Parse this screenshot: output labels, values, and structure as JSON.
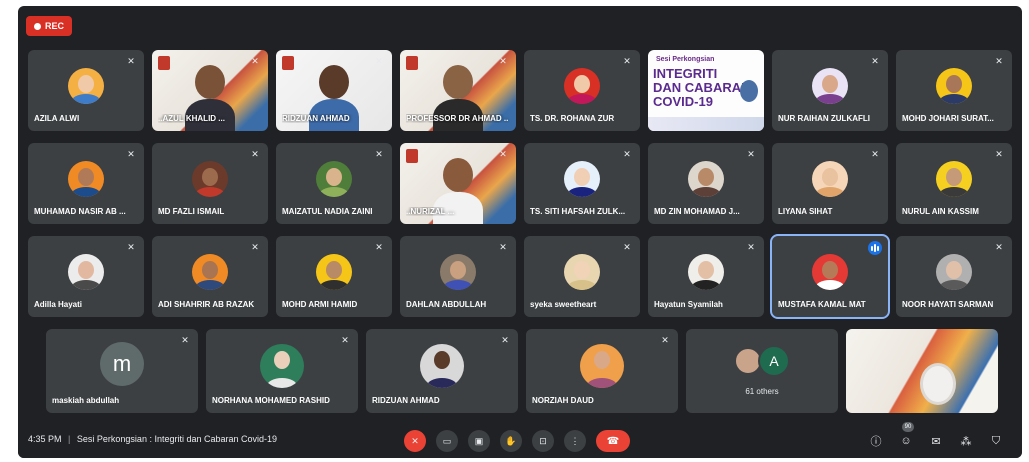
{
  "recording": {
    "label": "REC"
  },
  "participants": [
    {
      "name": "AZILA ALWI",
      "muted": true
    },
    {
      "name": "..AZUL KHALID ...",
      "muted": true
    },
    {
      "name": "RIDZUAN AHMAD",
      "muted": true
    },
    {
      "name": "PROFESSOR DR AHMAD ..",
      "muted": true
    },
    {
      "name": "TS. DR. ROHANA ZUR",
      "muted": true
    },
    {
      "name": "",
      "muted": true
    },
    {
      "name": "NUR RAIHAN ZULKAFLI",
      "muted": true
    },
    {
      "name": "MOHD JOHARI SURAT...",
      "muted": true
    },
    {
      "name": "MUHAMAD NASIR AB ...",
      "muted": true
    },
    {
      "name": "MD FAZLI ISMAIL",
      "muted": true
    },
    {
      "name": "MAIZATUL NADIA ZAINI",
      "muted": true
    },
    {
      "name": "..NURIZAL ...",
      "muted": true
    },
    {
      "name": "TS. SITI HAFSAH ZULK...",
      "muted": true
    },
    {
      "name": "MD ZIN MOHAMAD J...",
      "muted": true
    },
    {
      "name": "LIYANA SIHAT",
      "muted": true
    },
    {
      "name": "NURUL AIN KASSIM",
      "muted": true
    },
    {
      "name": "Adilla Hayati",
      "muted": true
    },
    {
      "name": "ADI SHAHRIR AB RAZAK",
      "muted": true
    },
    {
      "name": "MOHD ARMI HAMID",
      "muted": true
    },
    {
      "name": "DAHLAN ABDULLAH",
      "muted": true
    },
    {
      "name": "syeka sweetheart",
      "muted": true
    },
    {
      "name": "Hayatun Syamilah",
      "muted": true
    },
    {
      "name": "MUSTAFA KAMAL MAT",
      "speaking": true
    },
    {
      "name": "NOOR HAYATI SARMAN",
      "muted": true
    },
    {
      "name": "maskiah abdullah",
      "muted": true,
      "initial": "m"
    },
    {
      "name": "NORHANA MOHAMED RASHID",
      "muted": true
    },
    {
      "name": "RIDZUAN AHMAD",
      "muted": true
    },
    {
      "name": "NORZIAH DAUD",
      "muted": true
    }
  ],
  "slide": {
    "line1": "Sesi Perkongsian",
    "line2": "INTEGRITI",
    "line3": "DAN CABARAN",
    "line4": "COVID-19"
  },
  "others": {
    "initial": "A",
    "label": "61 others"
  },
  "bottom_bar": {
    "time": "4:35 PM",
    "separator": "|",
    "meeting_title": "Sesi Perkongsian : Integriti dan Cabaran Covid-19",
    "participant_count": "90"
  },
  "icons": {
    "mic_off": "mic-off-icon",
    "camera": "camera-icon",
    "captions": "captions-icon",
    "raise_hand": "raise-hand-icon",
    "present": "present-icon",
    "more": "more-options-icon",
    "end_call": "end-call-icon",
    "info": "info-icon",
    "people": "people-icon",
    "chat": "chat-icon",
    "activities": "activities-icon",
    "host_controls": "host-controls-icon"
  },
  "colors": {
    "accent": "#1a73e8",
    "danger": "#ea4335",
    "tile": "#3c4043",
    "background": "#202124"
  }
}
